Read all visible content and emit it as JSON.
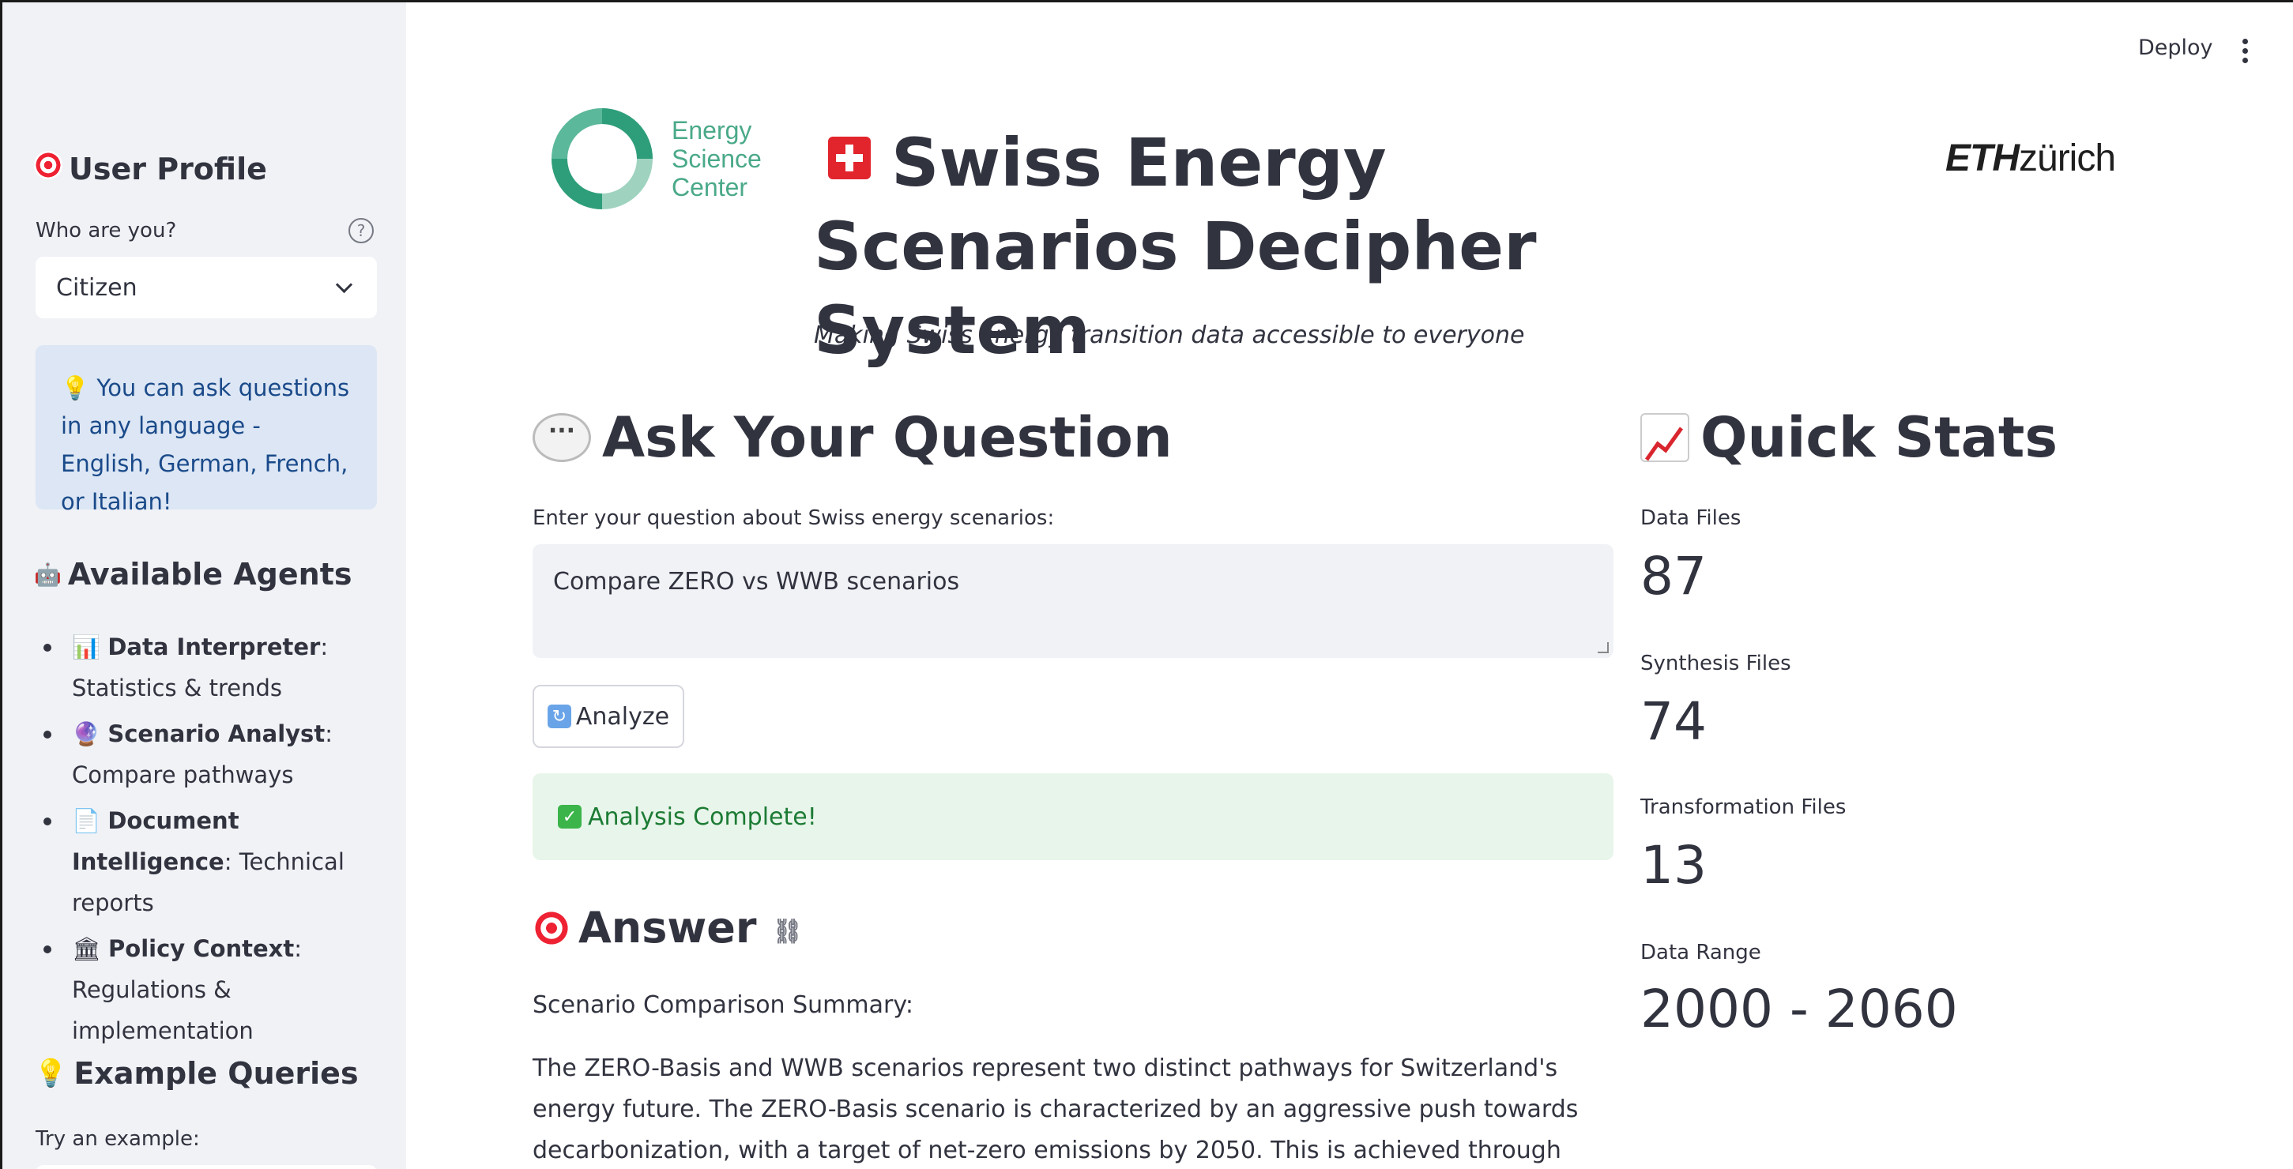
{
  "topbar": {
    "deploy_label": "Deploy"
  },
  "sidebar": {
    "profile_heading": "User Profile",
    "who_label": "Who are you?",
    "who_value": "Citizen",
    "info_text": "💡 You can ask questions in any language - English, German, French, or Italian!",
    "agents_heading": "Available Agents",
    "agents": [
      {
        "emoji": "📊",
        "name": "Data Interpreter",
        "desc": ": Statistics & trends"
      },
      {
        "emoji": "🔮",
        "name": "Scenario Analyst",
        "desc": ": Compare pathways"
      },
      {
        "emoji": "📄",
        "name": "Document Intelligence",
        "desc": ": Technical reports"
      },
      {
        "emoji": "🏛",
        "name": "Policy Context",
        "desc": ": Regulations & implementation"
      }
    ],
    "examples_heading": "Example Queries",
    "try_label": "Try an example:"
  },
  "header": {
    "logo_left_text": [
      "Energy",
      "Science",
      "Center"
    ],
    "logo_right_eth": "ETH",
    "logo_right_zurich": "zürich",
    "title": "Swiss Energy Scenarios Decipher System",
    "subtitle": "Making Swiss energy transition data accessible to everyone"
  },
  "question": {
    "heading": "Ask Your Question",
    "field_label": "Enter your question about Swiss energy scenarios:",
    "field_value": "Compare ZERO vs WWB scenarios",
    "analyze_label": "Analyze",
    "success_text": "Analysis Complete!"
  },
  "answer": {
    "heading": "Answer",
    "summary_label": "Scenario Comparison Summary:",
    "body": "The ZERO-Basis and WWB scenarios represent two distinct pathways for Switzerland's energy future. The ZERO-Basis scenario is characterized by an aggressive push towards decarbonization, with a target of net-zero emissions by 2050. This is achieved through accelerated renewable deployment,"
  },
  "stats": {
    "heading": "Quick Stats",
    "items": [
      {
        "label": "Data Files",
        "value": "87"
      },
      {
        "label": "Synthesis Files",
        "value": "74"
      },
      {
        "label": "Transformation Files",
        "value": "13"
      },
      {
        "label": "Data Range",
        "value": "2000 - 2060"
      }
    ]
  },
  "colors": {
    "sidebar_bg": "#f0f2f6",
    "info_bg": "#dce6f4",
    "success_bg": "#e8f5ea",
    "text": "#31333f"
  }
}
